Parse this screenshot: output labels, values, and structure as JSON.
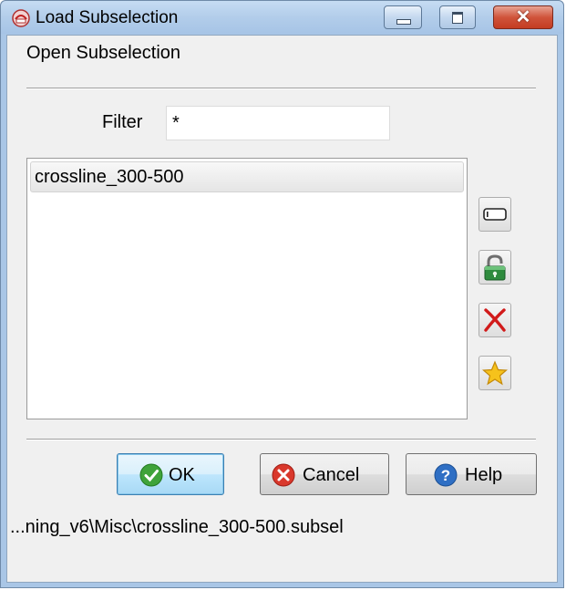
{
  "window": {
    "title": "Load Subselection",
    "heading": "Open Subselection"
  },
  "filter": {
    "label": "Filter",
    "value": "*"
  },
  "list": {
    "items": [
      "crossline_300-500"
    ],
    "selected_index": 0
  },
  "side_buttons": [
    {
      "name": "rename-button",
      "icon": "rename-field-icon"
    },
    {
      "name": "unlock-button",
      "icon": "open-padlock-icon"
    },
    {
      "name": "delete-button",
      "icon": "red-cross-icon"
    },
    {
      "name": "set-default-button",
      "icon": "star-icon"
    }
  ],
  "buttons": {
    "ok": "OK",
    "cancel": "Cancel",
    "help": "Help"
  },
  "status": {
    "path": "...ning_v6\\Misc\\crossline_300-500.subsel"
  },
  "colors": {
    "titlebar": "#b2cdea",
    "close_button": "#c43c22",
    "ok_icon": "#3fa33a",
    "cancel_icon": "#d9382c",
    "help_icon": "#2f6fc4",
    "delete_icon": "#d11a1a",
    "star_icon": "#f6c21b",
    "lock_icon": "#2e8b3d"
  }
}
